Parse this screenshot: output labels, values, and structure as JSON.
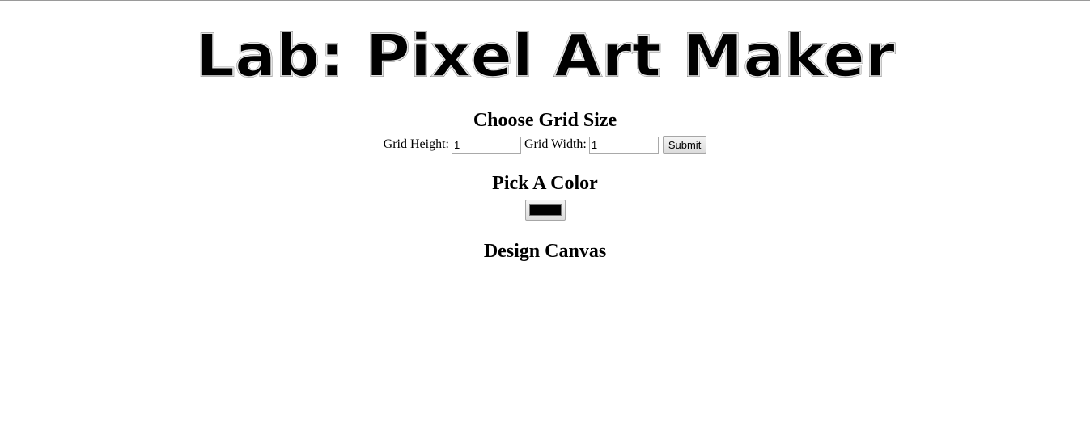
{
  "header": {
    "title": "Lab: Pixel Art Maker"
  },
  "grid_section": {
    "heading": "Choose Grid Size",
    "height_label": "Grid Height:",
    "height_value": "1",
    "width_label": "Grid Width:",
    "width_value": "1",
    "submit_label": "Submit"
  },
  "color_section": {
    "heading": "Pick A Color",
    "selected_color": "#000000"
  },
  "canvas_section": {
    "heading": "Design Canvas"
  }
}
